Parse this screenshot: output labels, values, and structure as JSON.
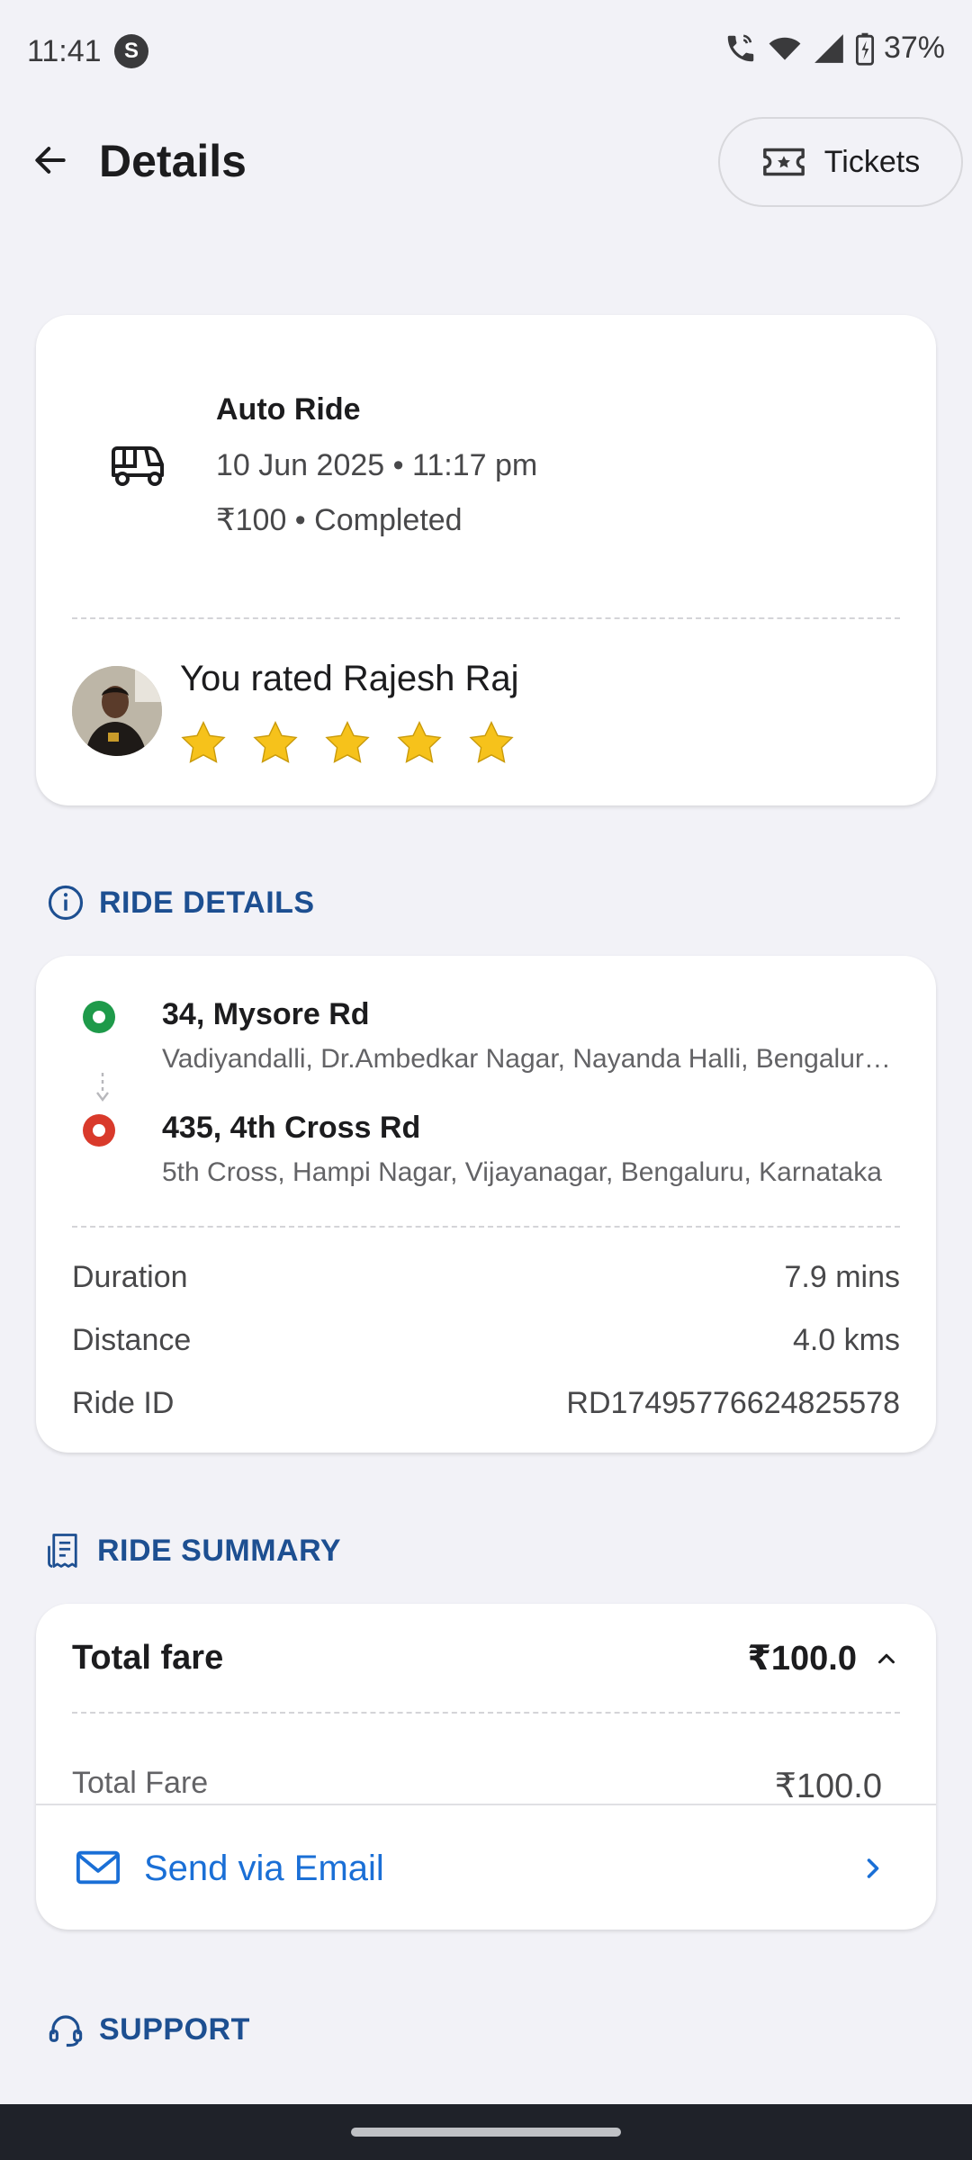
{
  "status_bar": {
    "time": "11:41",
    "app_icon": "S",
    "battery": "37%"
  },
  "header": {
    "title": "Details",
    "tickets_label": "Tickets"
  },
  "ride": {
    "title": "Auto Ride",
    "datetime": "10 Jun 2025 • 11:17 pm",
    "status": "₹100 • Completed",
    "rating_text": "You rated Rajesh Raj",
    "rating": 5,
    "rating_max": 5
  },
  "ride_details": {
    "section_label": "RIDE DETAILS",
    "pickup": {
      "title": "34, Mysore Rd",
      "address": "Vadiyandalli, Dr.Ambedkar Nagar, Nayanda Halli, Bengaluru, Karnataka"
    },
    "drop": {
      "title": "435, 4th Cross Rd",
      "address": "5th Cross, Hampi Nagar, Vijayanagar, Bengaluru, Karnataka"
    },
    "rows": [
      {
        "label": "Duration",
        "value": "7.9 mins"
      },
      {
        "label": "Distance",
        "value": "4.0 kms"
      },
      {
        "label": "Ride ID",
        "value": "RD17495776624825578"
      }
    ]
  },
  "ride_summary": {
    "section_label": "RIDE SUMMARY",
    "total_label": "Total fare",
    "total_value": "₹100.0",
    "sub_label": "Total Fare",
    "sub_value": "₹100.0",
    "email_label": "Send via Email"
  },
  "support": {
    "section_label": "SUPPORT"
  },
  "colors": {
    "accent_blue": "#1d4f91",
    "link_blue": "#1a6fd6",
    "pickup_green": "#1e9a4a",
    "drop_red": "#d93a2b",
    "star_yellow": "#f6c21b"
  }
}
